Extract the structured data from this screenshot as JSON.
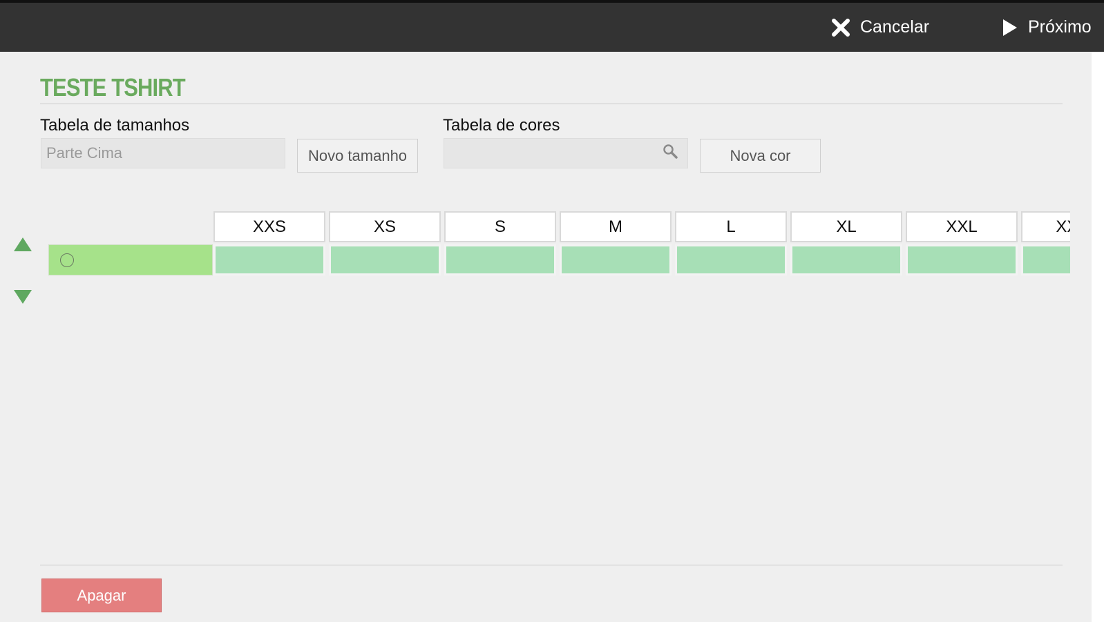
{
  "topbar": {
    "cancel_label": "Cancelar",
    "next_label": "Próximo"
  },
  "page": {
    "title": "TESTE TSHIRT"
  },
  "sizes": {
    "label": "Tabela de tamanhos",
    "input_value": "Parte Cima",
    "new_button": "Novo tamanho"
  },
  "colors_table": {
    "label": "Tabela de cores",
    "input_value": "",
    "new_button": "Nova cor"
  },
  "grid": {
    "columns": [
      "XXS",
      "XS",
      "S",
      "M",
      "L",
      "XL",
      "XXL",
      "XXXL"
    ],
    "rows": [
      {
        "selected": false
      }
    ]
  },
  "footer": {
    "delete_label": "Apagar"
  },
  "colors": {
    "topbar": "#333333",
    "title": "#6aaa5e",
    "row_header": "#a6e28a",
    "row_cell": "#a7dfb6",
    "delete": "#e47f7f",
    "arrow": "#5fa860"
  }
}
